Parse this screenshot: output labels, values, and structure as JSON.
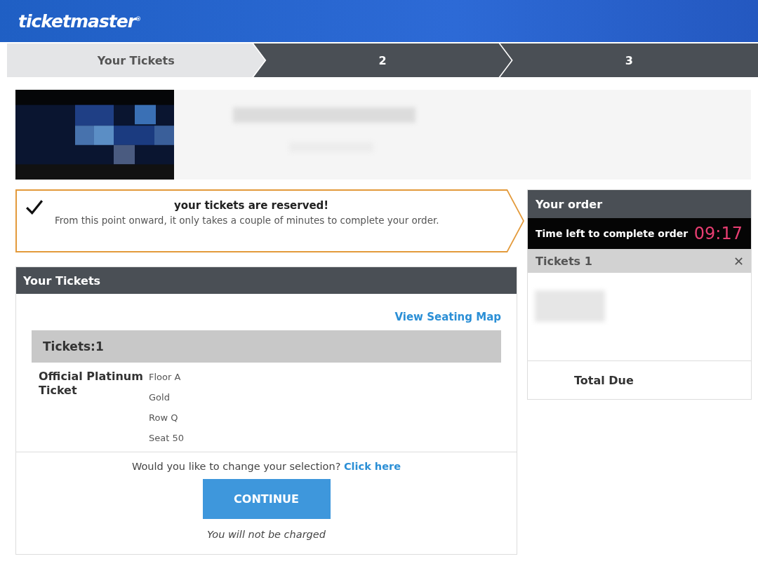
{
  "header": {
    "logo": "ticketmaster",
    "logo_mark": "®"
  },
  "steps": [
    {
      "label": "Your Tickets",
      "selected": true
    },
    {
      "label": "2",
      "selected": false
    },
    {
      "label": "3",
      "selected": false
    }
  ],
  "notice": {
    "title": "your tickets are reserved!",
    "message": "From this point onward, it only takes a couple of minutes to complete your order."
  },
  "tickets_panel": {
    "title": "Your Tickets",
    "map_link": "View Seating Map",
    "count_label": "Tickets:1",
    "ticket": {
      "name": "Official Platinum Ticket",
      "details": [
        "Floor A",
        "Gold",
        "Row Q",
        "Seat 50"
      ]
    },
    "change_prompt": "Would you like to change your selection?",
    "change_link": "Click here",
    "continue": "CONTINUE",
    "note": "You will not be charged"
  },
  "order": {
    "title": "Your order",
    "timer_label": "Time left to complete order",
    "timer": "09:17",
    "tickets_label": "Tickets 1",
    "remove": "✕",
    "total_label": "Total Due"
  }
}
